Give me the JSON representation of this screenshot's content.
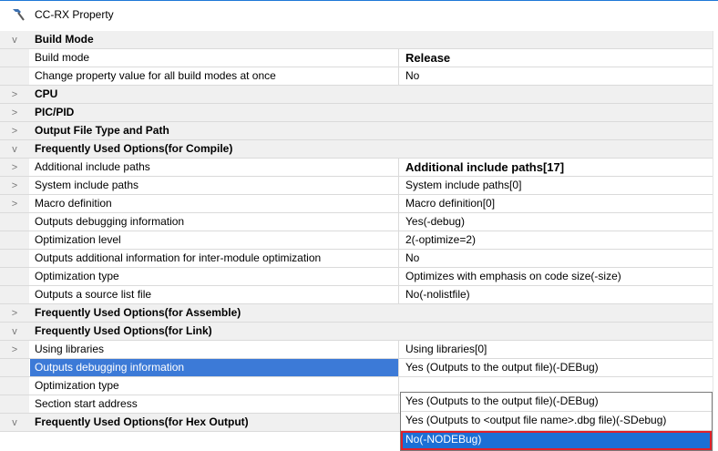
{
  "title": "CC-RX Property",
  "rows": [
    {
      "type": "category",
      "expander": "v",
      "name": "Build Mode"
    },
    {
      "type": "prop",
      "expander": "",
      "name": "Build mode",
      "value": "Release",
      "bold": true
    },
    {
      "type": "prop",
      "expander": "",
      "name": "Change property value for all build modes at once",
      "value": "No"
    },
    {
      "type": "category",
      "expander": ">",
      "name": "CPU"
    },
    {
      "type": "category",
      "expander": ">",
      "name": "PIC/PID"
    },
    {
      "type": "category",
      "expander": ">",
      "name": "Output File Type and Path"
    },
    {
      "type": "category",
      "expander": "v",
      "name": "Frequently Used Options(for Compile)"
    },
    {
      "type": "prop",
      "expander": ">",
      "name": "Additional include paths",
      "value": "Additional include paths[17]",
      "bold": true
    },
    {
      "type": "prop",
      "expander": ">",
      "name": "System include paths",
      "value": "System include paths[0]"
    },
    {
      "type": "prop",
      "expander": ">",
      "name": "Macro definition",
      "value": "Macro definition[0]"
    },
    {
      "type": "prop",
      "expander": "",
      "name": "Outputs debugging information",
      "value": "Yes(-debug)"
    },
    {
      "type": "prop",
      "expander": "",
      "name": "Optimization level",
      "value": "2(-optimize=2)"
    },
    {
      "type": "prop",
      "expander": "",
      "name": "Outputs additional information for inter-module optimization",
      "value": "No"
    },
    {
      "type": "prop",
      "expander": "",
      "name": "Optimization type",
      "value": "Optimizes with emphasis on code size(-size)"
    },
    {
      "type": "prop",
      "expander": "",
      "name": "Outputs a source list file",
      "value": "No(-nolistfile)"
    },
    {
      "type": "category",
      "expander": ">",
      "name": "Frequently Used Options(for Assemble)"
    },
    {
      "type": "category",
      "expander": "v",
      "name": "Frequently Used Options(for Link)"
    },
    {
      "type": "prop",
      "expander": ">",
      "name": "Using libraries",
      "value": "Using libraries[0]"
    },
    {
      "type": "prop",
      "expander": "",
      "name": "Outputs debugging information",
      "value": "Yes (Outputs to the output file)(-DEBug)",
      "selected": true
    },
    {
      "type": "prop",
      "expander": "",
      "name": "Optimization type",
      "value": ""
    },
    {
      "type": "prop",
      "expander": "",
      "name": "Section start address",
      "value": ""
    },
    {
      "type": "category",
      "expander": "v",
      "name": "Frequently Used Options(for Hex Output)"
    }
  ],
  "dropdown": {
    "options": [
      "Yes (Outputs to the output file)(-DEBug)",
      "Yes (Outputs to <output file name>.dbg file)(-SDebug)",
      "No(-NODEBug)"
    ],
    "selected_index": 2
  },
  "colors": {
    "selection": "#1b6fd6",
    "highlight_box": "#e0202a",
    "category_bg": "#f0f0f0"
  }
}
